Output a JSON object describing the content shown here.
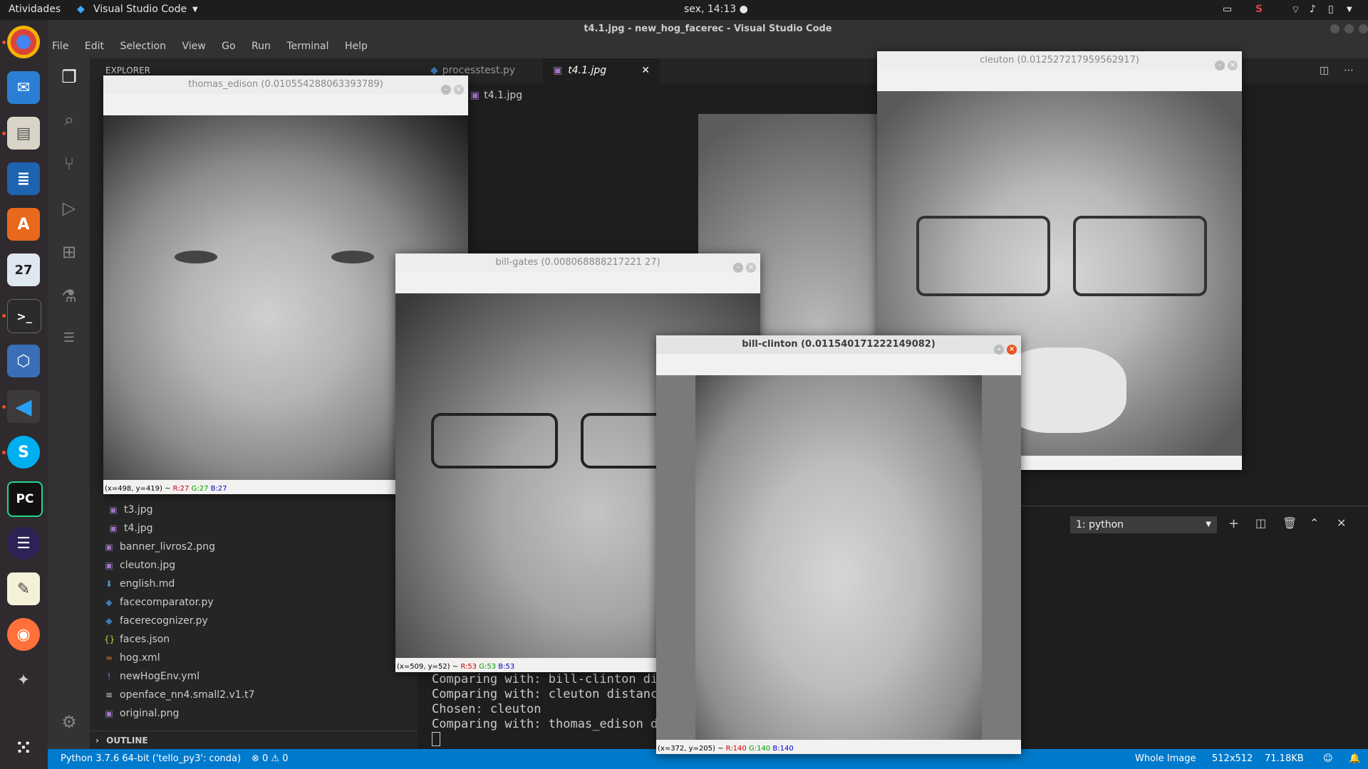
{
  "topbar": {
    "activities": "Atividades",
    "app_name": "Visual Studio Code",
    "clock": "sex, 14:13 ●"
  },
  "dock": {
    "calendar_day": "27"
  },
  "vscode": {
    "window_title": "t4.1.jpg - new_hog_facerec - Visual Studio Code",
    "menu": [
      "File",
      "Edit",
      "Selection",
      "View",
      "Go",
      "Run",
      "Terminal",
      "Help"
    ],
    "explorer_label": "EXPLORER",
    "tabs": [
      {
        "label": "processtest.py"
      },
      {
        "label": "t4.1.jpg"
      }
    ],
    "breadcrumb": "t4.1.jpg",
    "files": [
      {
        "name": "t3.jpg",
        "icon": "image-icon"
      },
      {
        "name": "t4.jpg",
        "icon": "image-icon"
      },
      {
        "name": "banner_livros2.png",
        "icon": "image-icon"
      },
      {
        "name": "cleuton.jpg",
        "icon": "image-icon"
      },
      {
        "name": "english.md",
        "icon": "markdown-icon"
      },
      {
        "name": "facecomparator.py",
        "icon": "python-icon"
      },
      {
        "name": "facerecognizer.py",
        "icon": "python-icon"
      },
      {
        "name": "faces.json",
        "icon": "json-icon"
      },
      {
        "name": "hog.xml",
        "icon": "rss-icon"
      },
      {
        "name": "newHogEnv.yml",
        "icon": "yaml-icon"
      },
      {
        "name": "openface_nn4.small2.v1.t7",
        "icon": "file-icon"
      },
      {
        "name": "original.png",
        "icon": "image-icon"
      }
    ],
    "outline_label": "OUTLINE",
    "terminal_select": "1: python",
    "terminal_lines": [
      "Comparing with: bill-clinton di",
      "Comparing with: cleuton distanc",
      "Chosen: cleuton",
      "Comparing with: thomas_edison d"
    ],
    "status": {
      "python": "Python 3.7.6 64-bit ('tello_py3': conda)",
      "errors": "⊗ 0 ⚠ 0",
      "whole_image": "Whole Image",
      "dims": "512x512",
      "size": "71.18KB"
    }
  },
  "windows": {
    "edison": {
      "title": "thomas_edison (0.010554288063393789)",
      "pixel": "(x=498, y=419) ~ ",
      "r": "R:27",
      "g": "G:27",
      "b": "B:27"
    },
    "gates": {
      "title": "bill-gates (0.008068888217221 27)",
      "pixel": "(x=509, y=52) ~ ",
      "r": "R:53",
      "g": "G:53",
      "b": "B:53"
    },
    "clinton": {
      "title": "bill-clinton (0.011540171222149082)",
      "pixel": "(x=372, y=205) ~ ",
      "r": "R:140",
      "g": "G:140",
      "b": "B:140"
    },
    "cleuton": {
      "title": "cleuton (0.012527217959562917)"
    }
  }
}
